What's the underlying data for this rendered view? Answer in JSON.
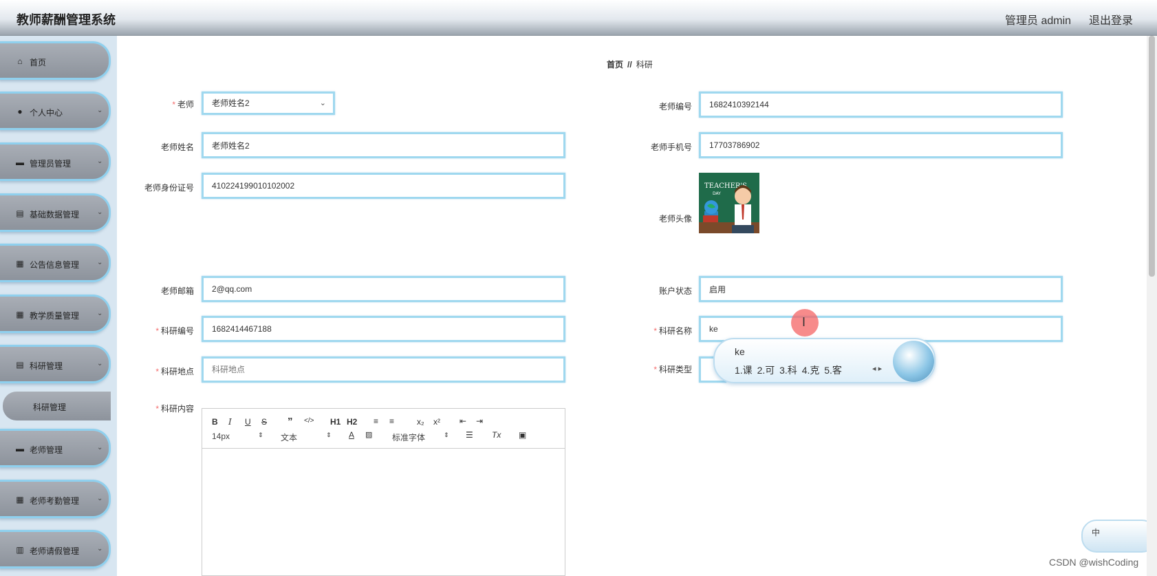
{
  "header": {
    "title": "教师薪酬管理系统",
    "admin": "管理员 admin",
    "logout": "退出登录"
  },
  "sidebar": {
    "items": [
      {
        "label": "首页",
        "icon": "home-icon"
      },
      {
        "label": "个人中心",
        "icon": "user-icon"
      },
      {
        "label": "管理员管理",
        "icon": "briefcase-icon"
      },
      {
        "label": "基础数据管理",
        "icon": "clipboard-icon"
      },
      {
        "label": "公告信息管理",
        "icon": "grid-icon"
      },
      {
        "label": "教学质量管理",
        "icon": "grid-icon"
      },
      {
        "label": "科研管理",
        "icon": "clipboard-icon"
      },
      {
        "label": "老师管理",
        "icon": "monitor-icon"
      },
      {
        "label": "老师考勤管理",
        "icon": "grid-icon"
      },
      {
        "label": "老师请假管理",
        "icon": "bar-chart-icon"
      }
    ],
    "submenu": {
      "label": "科研管理"
    }
  },
  "breadcrumb": {
    "home": "首页",
    "separator": "//",
    "current": "科研"
  },
  "form": {
    "teacher": {
      "label": "老师",
      "value": "老师姓名2"
    },
    "teacher_no": {
      "label": "老师编号",
      "value": "1682410392144"
    },
    "teacher_name": {
      "label": "老师姓名",
      "value": "老师姓名2"
    },
    "teacher_phone": {
      "label": "老师手机号",
      "value": "17703786902"
    },
    "teacher_id_card": {
      "label": "老师身份证号",
      "value": "410224199010102002"
    },
    "teacher_avatar": {
      "label": "老师头像"
    },
    "teacher_email": {
      "label": "老师邮箱",
      "value": "2@qq.com"
    },
    "account_status": {
      "label": "账户状态",
      "value": "启用"
    },
    "research_no": {
      "label": "科研编号",
      "value": "1682414467188"
    },
    "research_name": {
      "label": "科研名称",
      "value": "ke"
    },
    "research_place": {
      "label": "科研地点",
      "placeholder": "科研地点"
    },
    "research_type": {
      "label": "科研类型"
    },
    "research_content": {
      "label": "科研内容"
    }
  },
  "editor": {
    "font_size": "14px",
    "block_format": "文本",
    "font_family": "标准字体",
    "heading1": "H1",
    "heading2": "H2",
    "bold": "B",
    "italic": "I",
    "underline": "U",
    "strike": "S",
    "subscript": "x₂",
    "superscript": "x²",
    "font_color": "A",
    "clear_format": "Tx"
  },
  "ime": {
    "input": "ke",
    "candidates": "1.课 2.可 3.科 4.克 5.客",
    "tray_label": "中"
  },
  "watermark": "CSDN @wishCoding"
}
